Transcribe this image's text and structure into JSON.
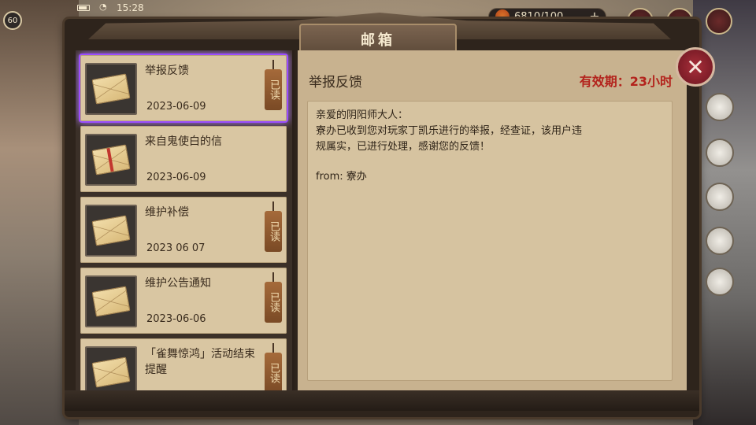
{
  "status_bar": {
    "time": "15:28",
    "player_level": "60"
  },
  "currency": {
    "value": "6810/100",
    "icon": "stamina-icon"
  },
  "mailbox": {
    "title": "邮箱",
    "mails": [
      {
        "title": "举报反馈",
        "date": "2023-06-09",
        "read_tag": "已读",
        "read": true,
        "selected": true,
        "icon": "envelope-icon"
      },
      {
        "title": "来自鬼使白的信",
        "date": "2023-06-09",
        "read_tag": "",
        "read": false,
        "selected": false,
        "icon": "envelope-ribbon-icon"
      },
      {
        "title": "维护补偿",
        "date": "2023  06  07",
        "read_tag": "已读",
        "read": true,
        "selected": false,
        "icon": "envelope-icon"
      },
      {
        "title": "维护公告通知",
        "date": "2023-06-06",
        "read_tag": "已读",
        "read": true,
        "selected": false,
        "icon": "envelope-icon"
      },
      {
        "title": "「雀舞惊鸿」活动结束提醒",
        "date": "",
        "read_tag": "已读",
        "read": true,
        "selected": false,
        "icon": "envelope-icon"
      }
    ]
  },
  "detail": {
    "title": "举报反馈",
    "expiry": "有效期：23小时",
    "greeting": "亲爱的阴阳师大人：",
    "body_line1": "寮办已收到您对玩家丁凯乐进行的举报，经查证，该用户违",
    "body_line2": "规属实，已进行处理，感谢您的反馈！",
    "signature": "from: 寮办"
  },
  "close_icon": "close-icon",
  "colors": {
    "selected_glow": "#9b4dff",
    "expiry_red": "#b3231c",
    "paper": "#d6c3a0"
  }
}
